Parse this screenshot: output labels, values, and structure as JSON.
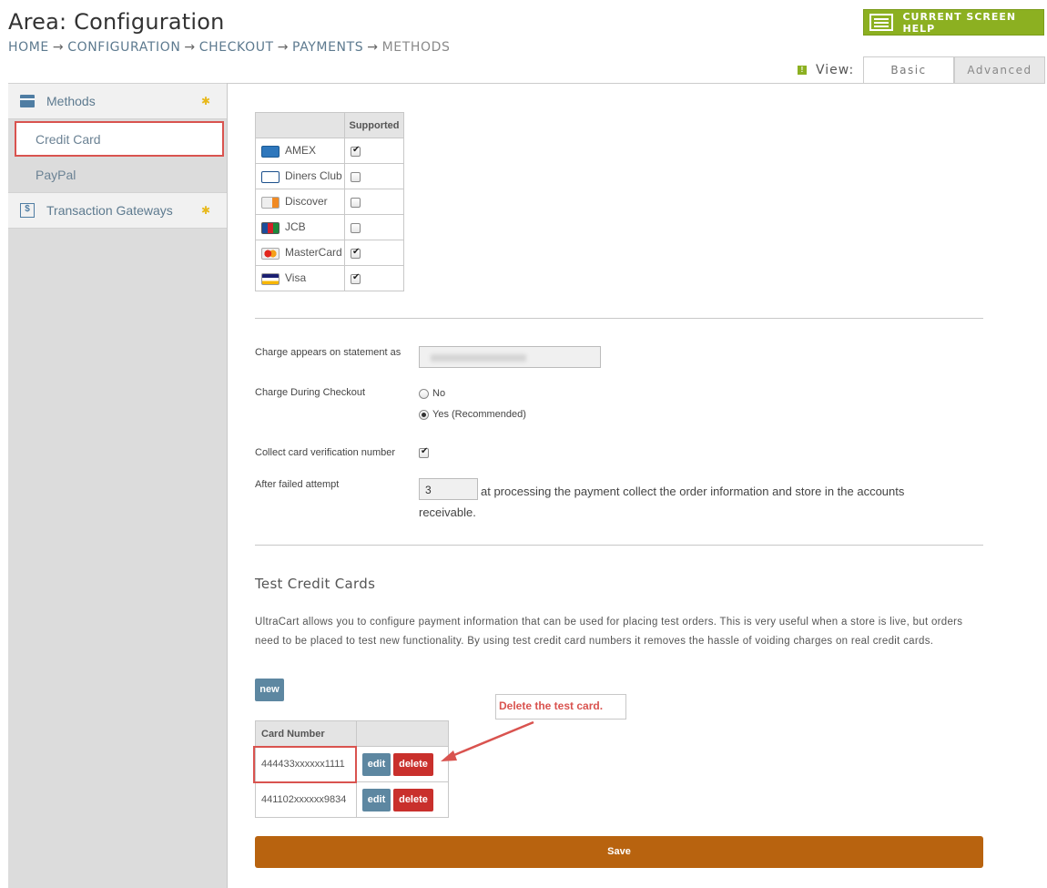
{
  "header": {
    "title": "Area: Configuration",
    "breadcrumb": {
      "home": "HOME",
      "configuration": "CONFIGURATION",
      "checkout": "CHECKOUT",
      "payments": "PAYMENTS",
      "current": "METHODS",
      "separator": "→"
    },
    "help_button": "CURRENT SCREEN HELP",
    "view_label": "View:",
    "tabs": {
      "basic": "Basic",
      "advanced": "Advanced"
    }
  },
  "sidebar": {
    "methods": "Methods",
    "credit_card": "Credit Card",
    "paypal": "PayPal",
    "transaction_gateways": "Transaction Gateways"
  },
  "cards_table": {
    "header_supported": "Supported",
    "rows": [
      {
        "name": "AMEX",
        "supported": true
      },
      {
        "name": "Diners Club",
        "supported": false
      },
      {
        "name": "Discover",
        "supported": false
      },
      {
        "name": "JCB",
        "supported": false
      },
      {
        "name": "MasterCard",
        "supported": true
      },
      {
        "name": "Visa",
        "supported": true
      }
    ]
  },
  "form": {
    "statement_label": "Charge appears on statement as",
    "charge_label": "Charge During Checkout",
    "charge_no": "No",
    "charge_yes": "Yes (Recommended)",
    "cvv_label": "Collect card verification number",
    "failed_label": "After failed attempt",
    "failed_value": "3",
    "failed_text": "at processing the payment collect the order information and store in the accounts receivable."
  },
  "test_cards": {
    "title": "Test Credit Cards",
    "description": "UltraCart allows you to configure payment information that can be used for placing test orders. This is very useful when a store is live, but orders need to be placed to test new functionality. By using test credit card numbers it removes the hassle of voiding charges on real credit cards.",
    "new_label": "new",
    "column_header": "Card Number",
    "rows": [
      {
        "number": "444433xxxxxx1111",
        "edit": "edit",
        "delete": "delete"
      },
      {
        "number": "441102xxxxxx9834",
        "edit": "edit",
        "delete": "delete"
      }
    ],
    "callout": "Delete the test card."
  },
  "save_label": "Save",
  "colors": {
    "accent_green": "#8cb021",
    "save_orange": "#b8630f",
    "delete_red": "#c9302c",
    "edit_blue": "#5d87a1",
    "highlight_red": "#d9534f"
  }
}
